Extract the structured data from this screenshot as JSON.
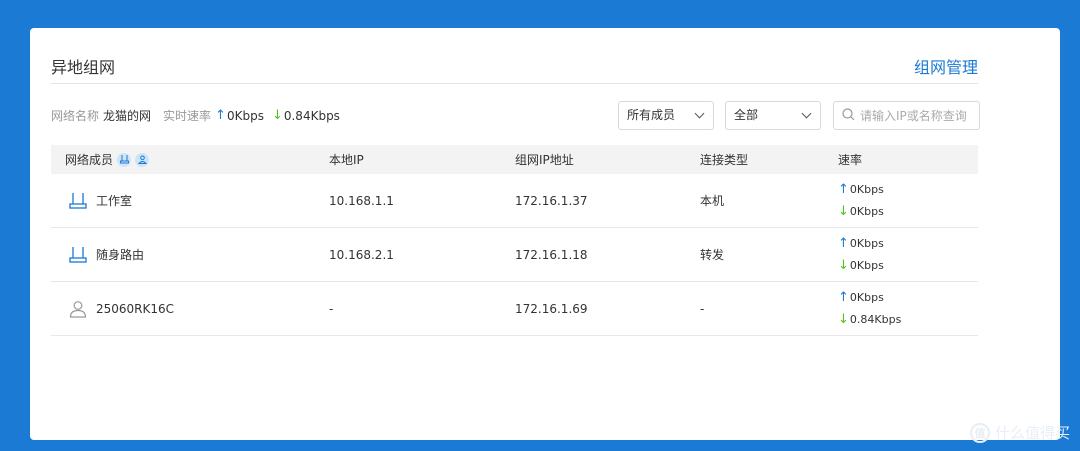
{
  "header": {
    "title": "异地组网",
    "manage_link": "组网管理"
  },
  "info": {
    "network_name_label": "网络名称",
    "network_name": "龙猫的网",
    "realtime_speed_label": "实时速率",
    "up_speed": "0Kbps",
    "down_speed": "0.84Kbps"
  },
  "filters": {
    "member_select": "所有成员",
    "type_select": "全部",
    "search_placeholder": "请输入IP或名称查询"
  },
  "table": {
    "columns": [
      "网络成员",
      "本地IP",
      "组网IP地址",
      "连接类型",
      "速率"
    ],
    "rows": [
      {
        "icon": "router-icon",
        "name": "工作室",
        "local_ip": "10.168.1.1",
        "net_ip": "172.16.1.37",
        "type": "本机",
        "up": "0Kbps",
        "down": "0Kbps"
      },
      {
        "icon": "router-icon",
        "name": "随身路由",
        "local_ip": "10.168.2.1",
        "net_ip": "172.16.1.18",
        "type": "转发",
        "up": "0Kbps",
        "down": "0Kbps"
      },
      {
        "icon": "user-icon",
        "name": "25060RK16C",
        "local_ip": "-",
        "net_ip": "172.16.1.69",
        "type": "-",
        "up": "0Kbps",
        "down": "0.84Kbps"
      }
    ]
  },
  "watermark": {
    "text": "什么值得买",
    "logo": "值"
  },
  "colors": {
    "accent": "#1a7ad4",
    "down_arrow": "#52c41a",
    "background": "#1a7ad4"
  }
}
